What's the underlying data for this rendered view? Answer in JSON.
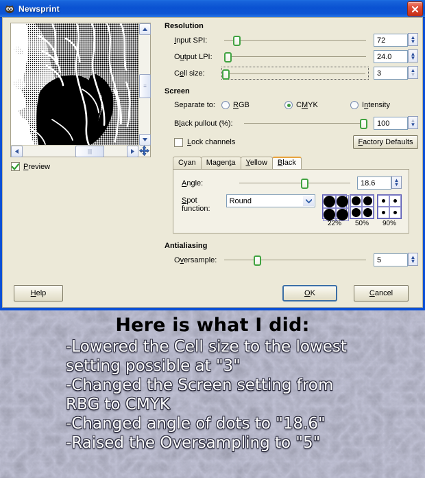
{
  "window": {
    "title": "Newsprint",
    "icon": "gimp-wilber-icon",
    "close_label": "×"
  },
  "preview": {
    "checkbox_label": "Preview",
    "checked": true,
    "pan_icon": "move-icon",
    "scroll_up_icon": "chevron-up-icon",
    "scroll_down_icon": "chevron-down-icon",
    "scroll_left_icon": "chevron-left-icon",
    "scroll_right_icon": "chevron-right-icon"
  },
  "resolution": {
    "title": "Resolution",
    "input_spi": {
      "label": "Input SPI:",
      "value": "72",
      "slider_pct": 8
    },
    "output_lpi": {
      "label": "Output LPI:",
      "value": "24.0",
      "slider_pct": 2
    },
    "cell_size": {
      "label": "Cell size:",
      "value": "3",
      "slider_pct": 0
    }
  },
  "screen": {
    "title": "Screen",
    "separate_label": "Separate to:",
    "options": [
      {
        "label": "RGB",
        "mnemonic": "R",
        "selected": false
      },
      {
        "label": "CMYK",
        "mnemonic": "M",
        "selected": true
      },
      {
        "label": "Intensity",
        "mnemonic": "n",
        "selected": false
      }
    ],
    "black_pullout": {
      "label": "Black pullout (%):",
      "value": "100",
      "slider_pct": 100
    },
    "lock_channels": {
      "label": "Lock channels",
      "checked": false
    },
    "factory_defaults": "Factory Defaults"
  },
  "channel_tabs": {
    "tabs": [
      {
        "label": "Cyan",
        "active": false
      },
      {
        "label": "Magenta",
        "active": false
      },
      {
        "label": "Yellow",
        "active": false
      },
      {
        "label": "Black",
        "active": true
      }
    ],
    "angle": {
      "label": "Angle:",
      "value": "18.6",
      "slider_pct": 55
    },
    "spot_function": {
      "label": "Spot function:",
      "value": "Round"
    },
    "swatches": [
      {
        "label": "22%",
        "dot": 17
      },
      {
        "label": "50%",
        "dot": 13
      },
      {
        "label": "90%",
        "dot": 5
      }
    ]
  },
  "antialiasing": {
    "title": "Antialiasing",
    "oversample": {
      "label": "Oversample:",
      "value": "5",
      "slider_pct": 22
    }
  },
  "buttons": {
    "help": "Help",
    "ok": "OK",
    "cancel": "Cancel"
  },
  "caption": {
    "heading": "Here is what I did:",
    "lines": [
      "-Lowered the Cell size to the lowest\n  setting possible at \"3\"",
      "-Changed the Screen setting from\n  RBG to CMYK",
      "-Changed angle of dots to \"18.6\"",
      "-Raised the Oversampling to \"5\""
    ]
  },
  "colors": {
    "title_blue": "#0a52d2",
    "dialog_face": "#ece9d8",
    "accent_green": "#41a341",
    "tab_active_orange": "#e8a33d",
    "close_red": "#c42d17"
  }
}
